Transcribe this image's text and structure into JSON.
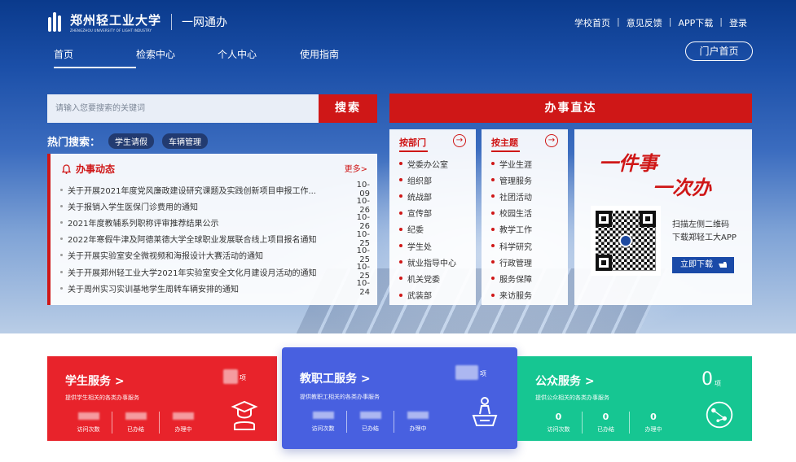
{
  "header": {
    "logo_name": "郑州轻工业大学",
    "logo_en": "ZHENGZHOU UNIVERSITY OF LIGHT INDUSTRY",
    "logo_sub": "一网通办",
    "toplinks": [
      "学校首页",
      "意见反馈",
      "APP下载",
      "登录"
    ],
    "nav": [
      "首页",
      "检索中心",
      "个人中心",
      "使用指南"
    ],
    "portal_button": "门户首页"
  },
  "search": {
    "placeholder": "请输入您要搜索的关键词",
    "button": "搜索",
    "hot_label": "热门搜索：",
    "hot_tags": [
      "学生请假",
      "车辆管理"
    ]
  },
  "news": {
    "title": "办事动态",
    "more": "更多>",
    "items": [
      {
        "title": "关于开展2021年度党风廉政建设研究课题及实践创新项目申报工作...",
        "date": "10-09"
      },
      {
        "title": "关于报销入学生医保门诊费用的通知",
        "date": "10-26"
      },
      {
        "title": "2021年度教辅系列职称评审推荐结果公示",
        "date": "10-26"
      },
      {
        "title": "2022年寒假牛津及阿德莱德大学全球职业发展联合线上项目报名通知",
        "date": "10-25"
      },
      {
        "title": "关于开展实验室安全微视频和海报设计大赛活动的通知",
        "date": "10-25"
      },
      {
        "title": "关于开展郑州轻工业大学2021年实验室安全文化月建设月活动的通知",
        "date": "10-25"
      },
      {
        "title": "关于周州实习实训基地学生周转车辆安排的通知",
        "date": "10-24"
      }
    ]
  },
  "banzhi": {
    "title": "办事直达",
    "dept": {
      "label": "按部门",
      "items": [
        "党委办公室",
        "组织部",
        "统战部",
        "宣传部",
        "纪委",
        "学生处",
        "就业指导中心",
        "机关党委",
        "武装部"
      ]
    },
    "topic": {
      "label": "按主题",
      "items": [
        "学业生涯",
        "管理服务",
        "社团活动",
        "校园生活",
        "教学工作",
        "科学研究",
        "行政管理",
        "服务保障",
        "来访服务"
      ]
    },
    "promo": {
      "line1": "一件事",
      "line2": "一次办",
      "scan_text_1": "扫描左侧二维码",
      "scan_text_2": "下载郑轻工大APP",
      "download_button": "立即下载"
    }
  },
  "services": [
    {
      "title": "学生服务 >",
      "desc": "提供学生相关的各类办事服务",
      "count": "",
      "unit": "项",
      "stats": [
        {
          "value": "",
          "label": "访问次数"
        },
        {
          "value": "",
          "label": "已办结"
        },
        {
          "value": "",
          "label": "办理中"
        }
      ],
      "color": "#e8232b",
      "icon": "graduate-icon"
    },
    {
      "title": "教职工服务 >",
      "desc": "提供教职工相关的各类办事服务",
      "count": "",
      "unit": "项",
      "stats": [
        {
          "value": "",
          "label": "访问次数"
        },
        {
          "value": "",
          "label": "已办结"
        },
        {
          "value": "",
          "label": "办理中"
        }
      ],
      "color": "#4860e0",
      "icon": "teacher-icon"
    },
    {
      "title": "公众服务 >",
      "desc": "提供公众相关的各类办事服务",
      "count": "0",
      "unit": "项",
      "stats": [
        {
          "value": "0",
          "label": "访问次数"
        },
        {
          "value": "0",
          "label": "已办结"
        },
        {
          "value": "0",
          "label": "办理中"
        }
      ],
      "color": "#16c692",
      "icon": "globe-icon"
    }
  ]
}
